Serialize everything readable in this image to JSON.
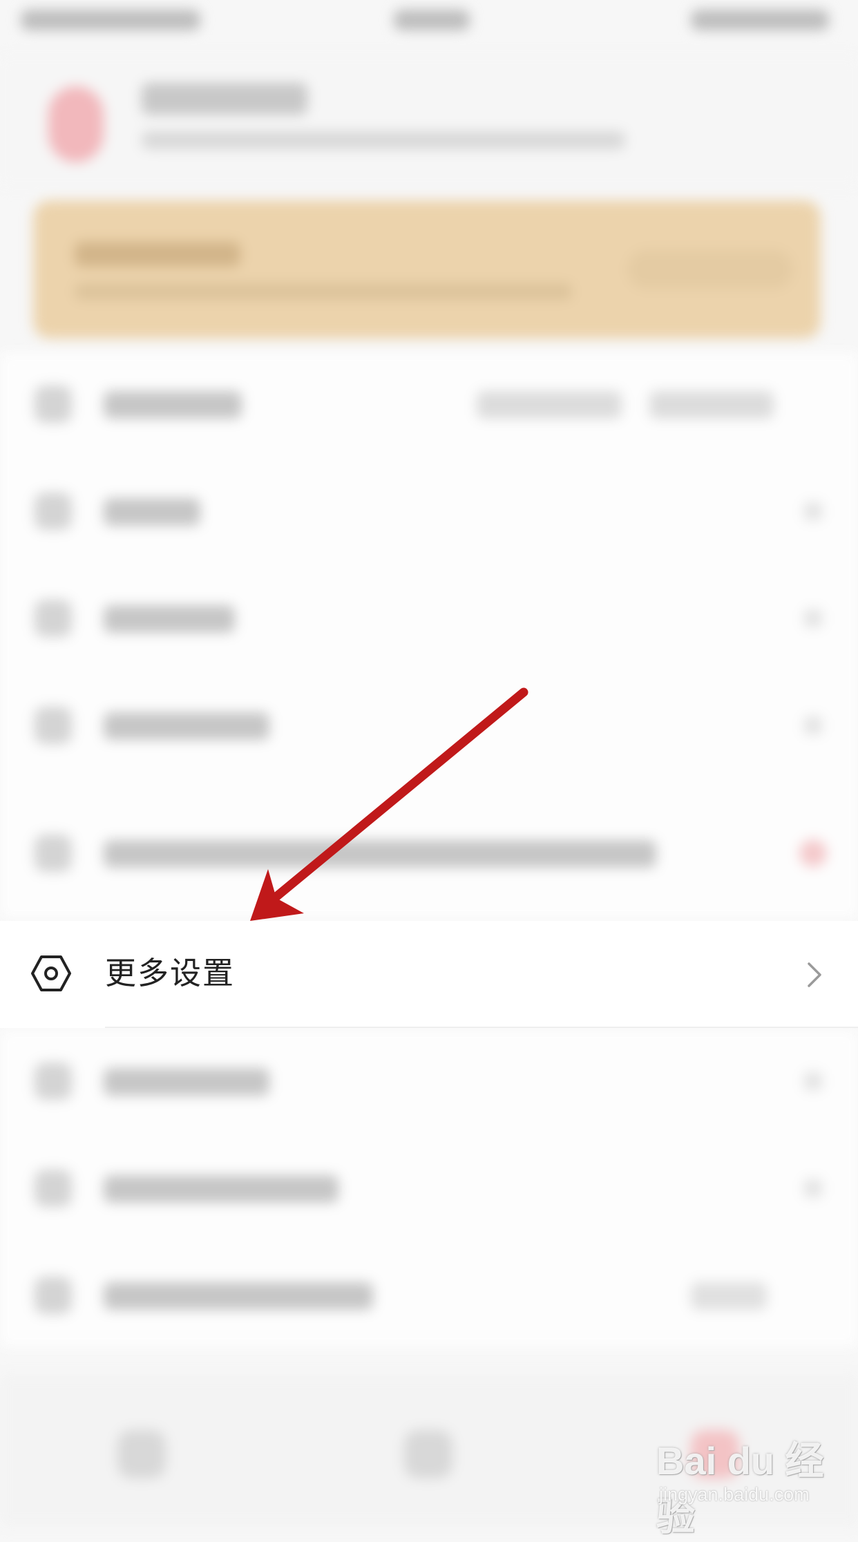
{
  "settings": {
    "more_settings_label": "更多设置"
  },
  "icons": {
    "settings": "hexagon-nut-icon",
    "chevron": "chevron-right-icon"
  },
  "watermark": {
    "logo": "Bai du 经验",
    "url": "jingyan.baidu.com"
  },
  "colors": {
    "arrow": "#c0191a",
    "avatar": "#f2b8bc",
    "vip_card": "#ecd3ac"
  }
}
